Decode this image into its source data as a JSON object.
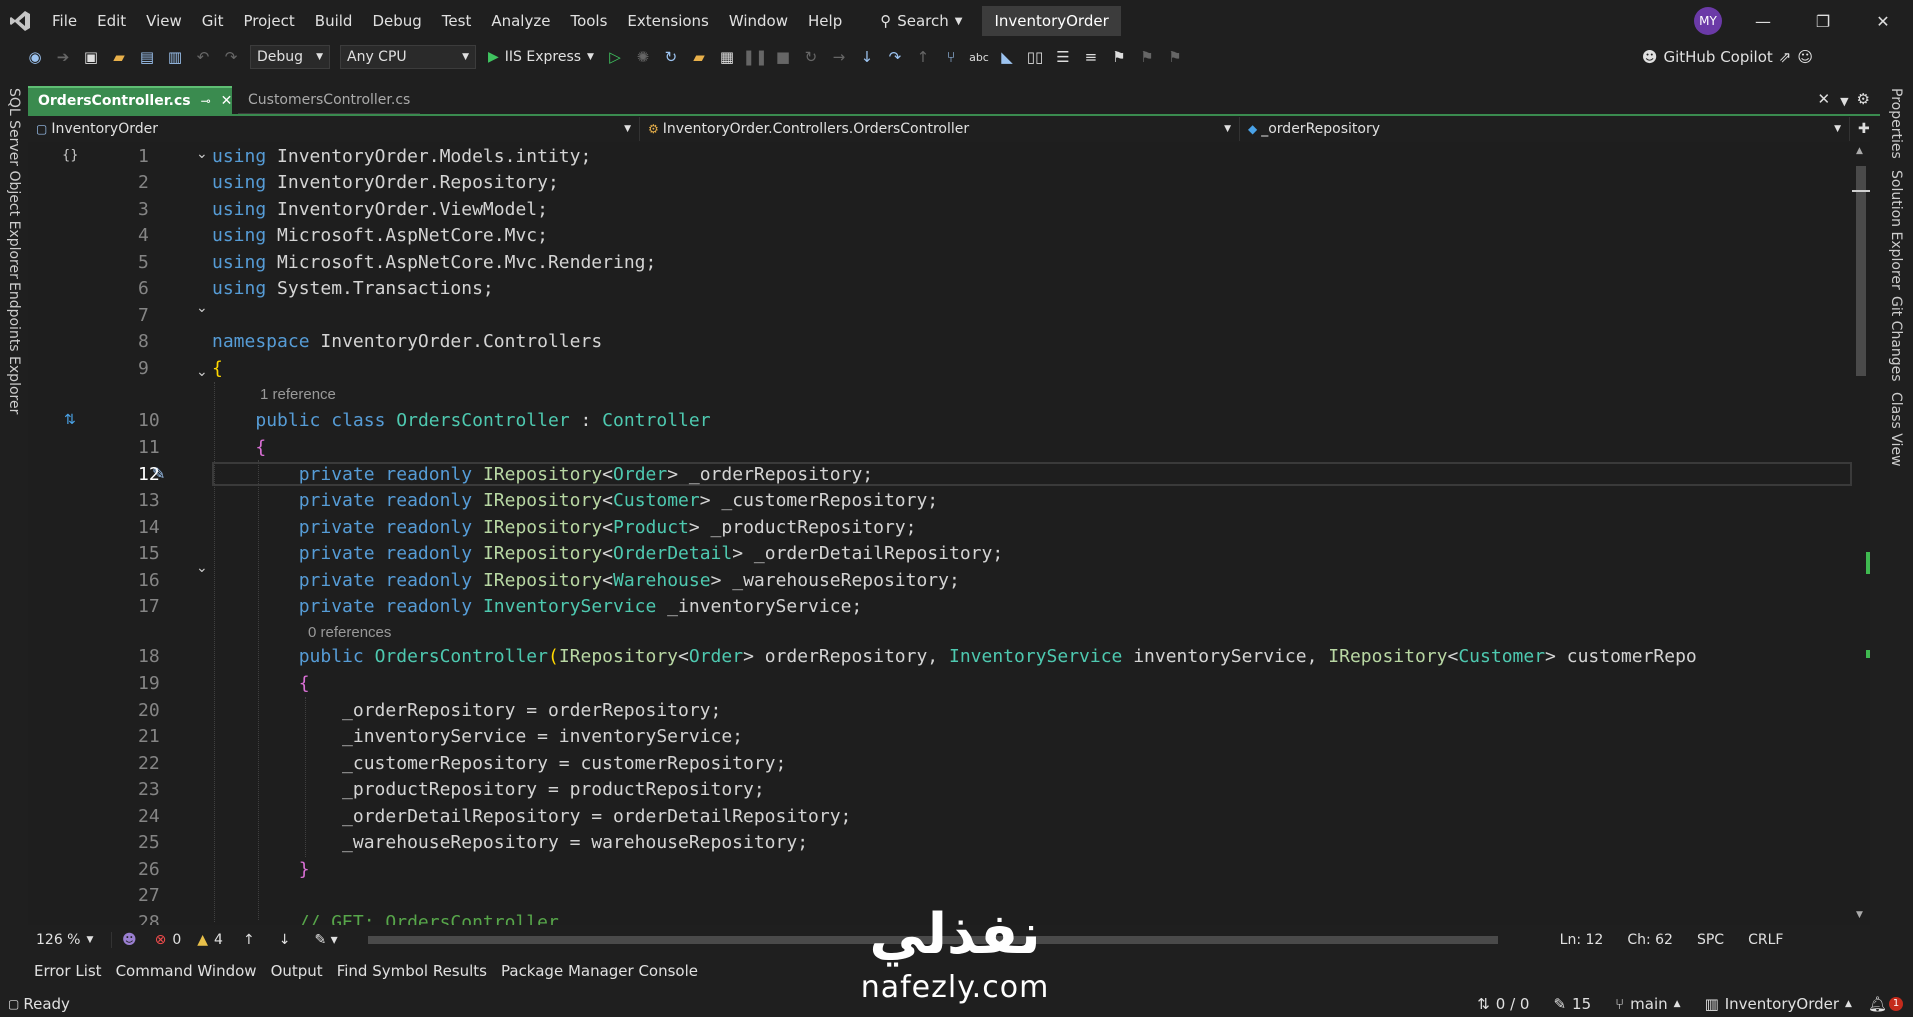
{
  "menubar": {
    "items": [
      "File",
      "Edit",
      "View",
      "Git",
      "Project",
      "Build",
      "Debug",
      "Test",
      "Analyze",
      "Tools",
      "Extensions",
      "Window",
      "Help"
    ],
    "search": "Search",
    "solution": "InventoryOrder",
    "avatar": "MY"
  },
  "toolbar": {
    "config": "Debug",
    "platform": "Any CPU",
    "run": "IIS Express",
    "copilot": "GitHub Copilot"
  },
  "left_rail": [
    "SQL Server Object Explorer",
    "Endpoints Explorer"
  ],
  "right_rail": [
    "Properties",
    "Solution Explorer",
    "Git Changes",
    "Class View"
  ],
  "tabs": [
    {
      "label": "OrdersController.cs",
      "active": true
    },
    {
      "label": "CustomersController.cs",
      "active": false
    }
  ],
  "navbar": {
    "project": "InventoryOrder",
    "type": "InventoryOrder.Controllers.OrdersController",
    "member": "_orderRepository"
  },
  "code": {
    "line_numbers": [
      "1",
      "2",
      "3",
      "4",
      "5",
      "6",
      "7",
      "8",
      "9",
      "10",
      "11",
      "12",
      "13",
      "14",
      "15",
      "16",
      "17",
      "18",
      "19",
      "20",
      "21",
      "22",
      "23",
      "24",
      "25",
      "26",
      "27",
      "28"
    ],
    "hint_1_reference": "1 reference",
    "hint_0_references": "0 references",
    "l1": "InventoryOrder.Models.intity;",
    "l2": "InventoryOrder.Repository;",
    "l3": "InventoryOrder.ViewModel;",
    "l4": "Microsoft.AspNetCore.Mvc;",
    "l5": "Microsoft.AspNetCore.Mvc.Rendering;",
    "l6": "System.Transactions;",
    "using": "using",
    "namespace": "namespace",
    "ns_name": "InventoryOrder.Controllers",
    "public": "public",
    "class": "class",
    "class_name": "OrdersController",
    "base": "Controller",
    "private": "private",
    "readonly": "readonly",
    "IRepository": "IRepository",
    "InventoryService": "InventoryService",
    "Order": "Order",
    "Customer": "Customer",
    "Product": "Product",
    "OrderDetail": "OrderDetail",
    "Warehouse": "Warehouse",
    "f_order": " _orderRepository;",
    "f_customer": " _customerRepository;",
    "f_product": " _productRepository;",
    "f_orderdetail": " _orderDetailRepository;",
    "f_warehouse": " _warehouseRepository;",
    "f_inventory": " _inventoryService;",
    "ctor_p1": " orderRepository, ",
    "ctor_p2": " inventoryService, ",
    "ctor_p3": " customerRepo",
    "a20": "_orderRepository = orderRepository;",
    "a21": "_inventoryService = inventoryService;",
    "a22": "_customerRepository = customerRepository;",
    "a23": "_productRepository = productRepository;",
    "a24": "_orderDetailRepository = orderDetailRepository;",
    "a25": "_warehouseRepository = warehouseRepository;",
    "comment": "// GET: OrdersController"
  },
  "editor_status": {
    "zoom": "126 %",
    "errors": "0",
    "warnings": "4",
    "ln": "Ln: 12",
    "ch": "Ch: 62",
    "enc": "SPC",
    "eol": "CRLF"
  },
  "tool_windows": [
    "Error List",
    "Command Window",
    "Output",
    "Find Symbol Results",
    "Package Manager Console"
  ],
  "status": {
    "ready": "Ready",
    "updown": "0 / 0",
    "edits": "15",
    "branch": "main",
    "repo": "InventoryOrder",
    "notif": "1"
  },
  "watermark": {
    "arabic": "نفذلي",
    "latin": "nafezly.com"
  },
  "colors": {
    "accent_tab": "#3a8b4f",
    "keyword": "#569cd6",
    "type": "#4ec9b0",
    "comment": "#57a64a"
  }
}
